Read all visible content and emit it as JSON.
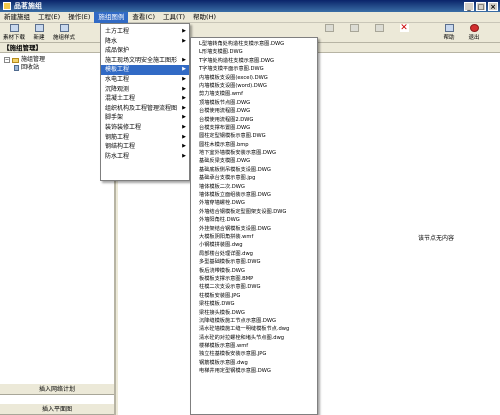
{
  "window": {
    "title": "品茗施组"
  },
  "menubar": {
    "items": [
      "新建施组",
      "工程(E)",
      "操作(E)",
      "施组图例",
      "查看(C)",
      "工具(T)",
      "帮助(H)"
    ]
  },
  "toolbar": {
    "left": [
      "素材下载",
      "新建",
      "施组样式"
    ],
    "right": [
      "帮助",
      "退出"
    ]
  },
  "left_panel": {
    "header": "【施组管理】",
    "tree": {
      "root": "施组管理",
      "child": "回收站"
    },
    "buttons": [
      "插入网络计划",
      "插入平面图"
    ]
  },
  "submenu_level1": {
    "items": [
      {
        "label": "土方工程",
        "arrow": "▶"
      },
      {
        "label": "降水",
        "arrow": "▶"
      },
      {
        "label": "成品保护",
        "arrow": ""
      },
      {
        "label": "施工现场文明安全施工图形",
        "arrow": "▶"
      },
      {
        "label": "模板工程",
        "arrow": "▶"
      },
      {
        "label": "水电工程",
        "arrow": "▶"
      },
      {
        "label": "沉降观测",
        "arrow": "▶"
      },
      {
        "label": "混凝土工程",
        "arrow": "▶"
      },
      {
        "label": "组织机构及工程管理流程图",
        "arrow": "▶"
      },
      {
        "label": "脚手架",
        "arrow": "▶"
      },
      {
        "label": "装饰装修工程",
        "arrow": "▶"
      },
      {
        "label": "钢筋工程",
        "arrow": "▶"
      },
      {
        "label": "钢结构工程",
        "arrow": "▶"
      },
      {
        "label": "防水工程",
        "arrow": "▶"
      }
    ]
  },
  "submenu_level2": {
    "items": [
      "L型墙转角处构造柱支模示意图.DWG",
      "L形墙支模图.DWG",
      "T字墙处构造柱支模示意图.DWG",
      "T字墙支模平面示意图.DWG",
      "内墙模板支设图(excel).DWG",
      "内墙模板支设图(word).DWG",
      "剪力墙支模图.wmf",
      "顶墙模板节点图.DWG",
      "台模使用流程图.DWG",
      "台模使用流程图2.DWG",
      "台模支撑布置图.DWG",
      "圆柱定型钢模板示意图.DWG",
      "圆柱木模示意图.bmp",
      "地下室外墙模板安装示意图.DWG",
      "基础反梁支模图.DWG",
      "基础底板侧吊模板支设图.DWG",
      "基础承台支模示意图.jpg",
      "墙体模板二次.DWG",
      "墙体模板立面组装示意图.DWG",
      "外墙穿墙螺栓.DWG",
      "外墙结合钢模板定型图架支设图.DWG",
      "外墙阳角柱.DWG",
      "外挂架结合钢模板支设图.DWG",
      "大模板阴阳角拼装.wmf",
      "小钢模拼装图.dwg",
      "局部楼台处理详图.dwg",
      "多型基础模板示意图.DWG",
      "板后浇带模板.DWG",
      "板模板支撑示意图.BMP",
      "柱模二次支设示意图.DWG",
      "柱模板安装图.JPG",
      "梁柱模板.DWG",
      "梁柱接头模板.DWG",
      "沉降缝模板施工节点示意图.DWG",
      "清水砼墙模施工缝一明缝模板节点.dwg",
      "清水砼的对拉螺栓和堵头节点图.dwg",
      "楼梯模板示意图.wmf",
      "独立柱基模板安装示意图.JPG",
      "钢筋模板示意图.dwg",
      "电梯井用定型钢模示意图.DWG"
    ]
  },
  "content": {
    "empty_text": "该节点无内容"
  }
}
